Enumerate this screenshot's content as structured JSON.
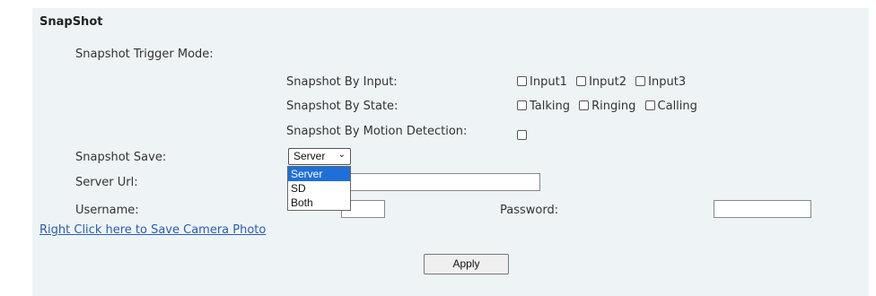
{
  "section": {
    "title": "SnapShot"
  },
  "trigger": {
    "mode_label": "Snapshot Trigger Mode:",
    "by_input": {
      "label": "Snapshot By Input:",
      "options": [
        "Input1",
        "Input2",
        "Input3"
      ]
    },
    "by_state": {
      "label": "Snapshot By State:",
      "options": [
        "Talking",
        "Ringing",
        "Calling"
      ]
    },
    "by_motion": {
      "label": "Snapshot By Motion Detection:"
    }
  },
  "save": {
    "label": "Snapshot Save:",
    "selected": "Server",
    "options": [
      "Server",
      "SD",
      "Both"
    ]
  },
  "server_url": {
    "label": "Server Url:",
    "value": ""
  },
  "username": {
    "label": "Username:",
    "value": ""
  },
  "password": {
    "label": "Password:",
    "value": ""
  },
  "link": {
    "text": "Right Click here to Save Camera Photo"
  },
  "apply": {
    "label": "Apply"
  },
  "colors": {
    "panel_bg": "#eef4f6",
    "link": "#2a5db0",
    "selection": "#1e6fd9"
  }
}
